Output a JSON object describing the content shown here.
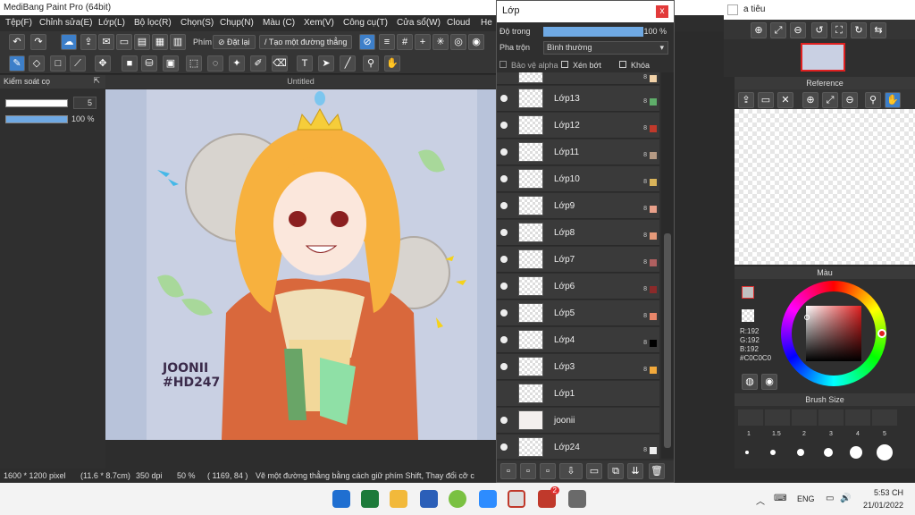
{
  "title": "MediBang Paint Pro (64bit)",
  "menu": [
    "Tệp(F)",
    "Chỉnh sửa(E)",
    "Lớp(L)",
    "Bộ lọc(R)",
    "Chọn(S)",
    "Chụp(N)",
    "Màu (C)",
    "Xem(V)",
    "Công cụ(T)",
    "Cửa sổ(W)",
    "Cloud",
    "He"
  ],
  "toolbar": {
    "phim_label": "Phím",
    "reset_label": "Đặt lại",
    "straight_line_label": "Tạo một đường thẳng"
  },
  "brush_control": {
    "title": "Kiểm soát cọ",
    "size_value": "5",
    "opacity_value": "100 %"
  },
  "canvas": {
    "tab_title": "Untitled",
    "signature_line1": "JOONII",
    "signature_line2": "#HD247"
  },
  "layers": {
    "title": "Lớp",
    "close": "x",
    "opacity_label": "Độ trong",
    "opacity_value": "100 %",
    "blend_label": "Pha trộn",
    "blend_value": "Bình thường",
    "protect_alpha": "Bảo vệ alpha",
    "clipping": "Xén bớt",
    "lock": "Khóa",
    "items": [
      {
        "name": "Lớp13",
        "opacity": "8",
        "color": "#5fae6a"
      },
      {
        "name": "Lớp12",
        "opacity": "8",
        "color": "#c0392b"
      },
      {
        "name": "Lớp11",
        "opacity": "8",
        "color": "#b59a84"
      },
      {
        "name": "Lớp10",
        "opacity": "8",
        "color": "#d9b45a"
      },
      {
        "name": "Lớp9",
        "opacity": "8",
        "color": "#e9a08a"
      },
      {
        "name": "Lớp8",
        "opacity": "8",
        "color": "#e69a7a"
      },
      {
        "name": "Lớp7",
        "opacity": "8",
        "color": "#b06060"
      },
      {
        "name": "Lớp6",
        "opacity": "8",
        "color": "#8b2a2a"
      },
      {
        "name": "Lớp5",
        "opacity": "8",
        "color": "#e8866a"
      },
      {
        "name": "Lớp4",
        "opacity": "8",
        "color": "#000000"
      },
      {
        "name": "Lớp3",
        "opacity": "8",
        "color": "#f2a93b"
      },
      {
        "name": "Lớp1",
        "opacity": "",
        "color": ""
      },
      {
        "name": "joonii",
        "opacity": "",
        "color": ""
      },
      {
        "name": "Lớp24",
        "opacity": "8",
        "color": "#eee"
      }
    ]
  },
  "navigator": {
    "title": "a tiêu"
  },
  "reference": {
    "title": "Reference"
  },
  "color": {
    "title": "Màu",
    "r": "R:192",
    "g": "G:192",
    "b": "B:192",
    "hex": "#C0C0C0"
  },
  "brush_size": {
    "title": "Brush Size",
    "labels": [
      "1",
      "1.5",
      "2",
      "3",
      "4",
      "5"
    ]
  },
  "status": {
    "size": "1600 * 1200 pixel",
    "cm": "(11.6 * 8.7cm)",
    "dpi": "350 dpi",
    "zoom": "50 %",
    "coords": "( 1169, 84 )",
    "hint": "Vẽ một đường thẳng bằng cách giữ phím Shift, Thay đổi cỡ c"
  },
  "taskbar": {
    "lang": "ENG",
    "time": "5:53 CH",
    "date": "21/01/2022",
    "badge": "2"
  }
}
